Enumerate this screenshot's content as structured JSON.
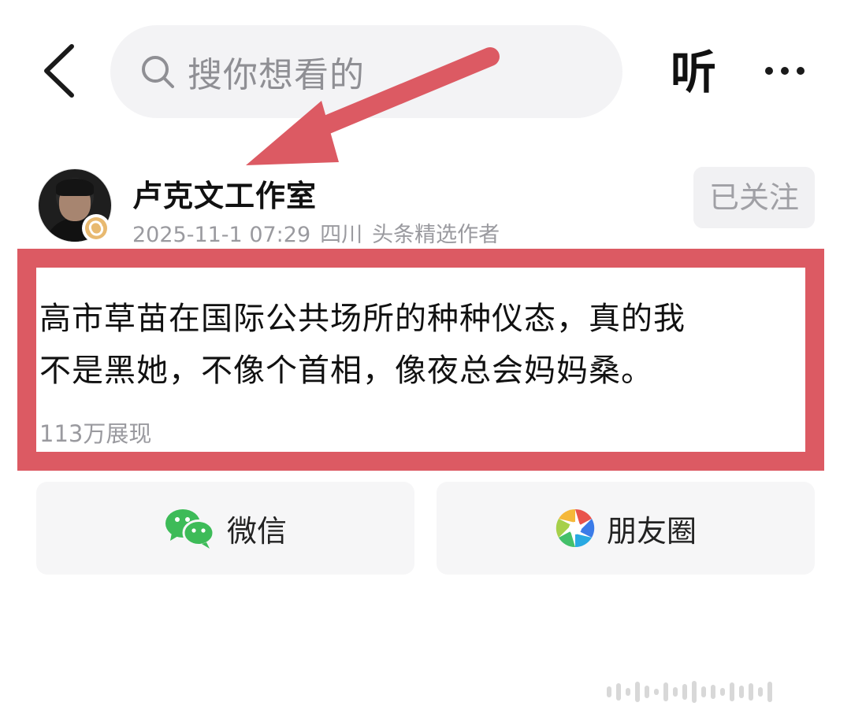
{
  "header": {
    "search_placeholder": "搜你想看的",
    "listen_label": "听"
  },
  "author": {
    "name": "卢克文工作室",
    "date": "2025-11-1 07:29",
    "location": "四川",
    "tag": "头条精选作者",
    "follow_label": "已关注"
  },
  "post": {
    "line1": "高市草苗在国际公共场所的种种仪态，真的我",
    "line2": "不是黑她，不像个首相，像夜总会妈妈桑。",
    "views": "113万展现"
  },
  "share": {
    "wechat_label": "微信",
    "moments_label": "朋友圈"
  },
  "colors": {
    "highlight": "#dc5a63",
    "wechat_green": "#3dbb58"
  }
}
